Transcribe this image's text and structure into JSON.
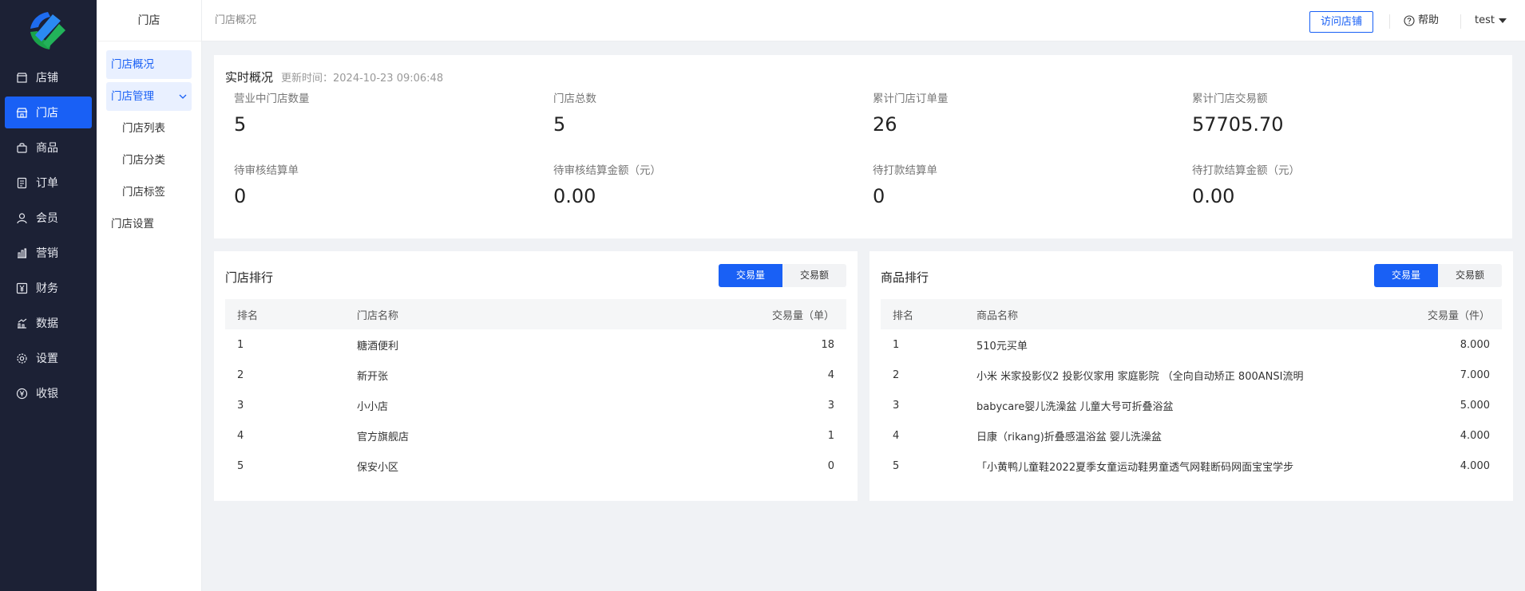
{
  "colors": {
    "accent": "#1960f5",
    "sidebar_bg": "#1c2135"
  },
  "sidebar": {
    "items": [
      {
        "label": "店铺",
        "icon": "store-icon",
        "active": false
      },
      {
        "label": "门店",
        "icon": "shop-icon",
        "active": true
      },
      {
        "label": "商品",
        "icon": "bag-icon",
        "active": false
      },
      {
        "label": "订单",
        "icon": "order-icon",
        "active": false
      },
      {
        "label": "会员",
        "icon": "user-icon",
        "active": false
      },
      {
        "label": "营销",
        "icon": "chart-bars-icon",
        "active": false
      },
      {
        "label": "财务",
        "icon": "yen-icon",
        "active": false
      },
      {
        "label": "数据",
        "icon": "data-icon",
        "active": false
      },
      {
        "label": "设置",
        "icon": "gear-icon",
        "active": false
      },
      {
        "label": "收银",
        "icon": "cashier-icon",
        "active": false
      }
    ]
  },
  "subnav": {
    "title": "门店",
    "items": [
      {
        "label": "门店概况"
      },
      {
        "label": "门店管理"
      },
      {
        "label": "门店列表"
      },
      {
        "label": "门店分类"
      },
      {
        "label": "门店标签"
      },
      {
        "label": "门店设置"
      }
    ]
  },
  "header": {
    "breadcrumb": "门店概况",
    "visit_label": "访问店铺",
    "help_label": "帮助",
    "user_label": "test"
  },
  "overview": {
    "title": "实时概况",
    "updated": "更新时间：2024-10-23 09:06:48",
    "stats": [
      {
        "label": "营业中门店数量",
        "value": "5"
      },
      {
        "label": "门店总数",
        "value": "5"
      },
      {
        "label": "累计门店订单量",
        "value": "26"
      },
      {
        "label": "累计门店交易额",
        "value": "57705.70"
      },
      {
        "label": "待审核结算单",
        "value": "0"
      },
      {
        "label": "待审核结算金额（元）",
        "value": "0.00"
      },
      {
        "label": "待打款结算单",
        "value": "0"
      },
      {
        "label": "待打款结算金额（元）",
        "value": "0.00"
      }
    ]
  },
  "store_rank": {
    "title": "门店排行",
    "tabs": [
      "交易量",
      "交易额"
    ],
    "columns": [
      "排名",
      "门店名称",
      "交易量（单）"
    ],
    "rows": [
      [
        "1",
        "糖酒便利",
        "18"
      ],
      [
        "2",
        "新开张",
        "4"
      ],
      [
        "3",
        "小小店",
        "3"
      ],
      [
        "4",
        "官方旗舰店",
        "1"
      ],
      [
        "5",
        "保安小区",
        "0"
      ]
    ]
  },
  "goods_rank": {
    "title": "商品排行",
    "tabs": [
      "交易量",
      "交易额"
    ],
    "columns": [
      "排名",
      "商品名称",
      "交易量（件）"
    ],
    "rows": [
      [
        "1",
        "510元买单",
        "8.000"
      ],
      [
        "2",
        "小米 米家投影仪2 投影仪家用 家庭影院 （全向自动矫正 800ANSI流明",
        "7.000"
      ],
      [
        "3",
        "babycare婴儿洗澡盆 儿童大号可折叠浴盆",
        "5.000"
      ],
      [
        "4",
        "日康（rikang)折叠感温浴盆 婴儿洗澡盆",
        "4.000"
      ],
      [
        "5",
        "「小黄鸭儿童鞋2022夏季女童运动鞋男童透气网鞋断码网面宝宝学步",
        "4.000"
      ]
    ]
  }
}
